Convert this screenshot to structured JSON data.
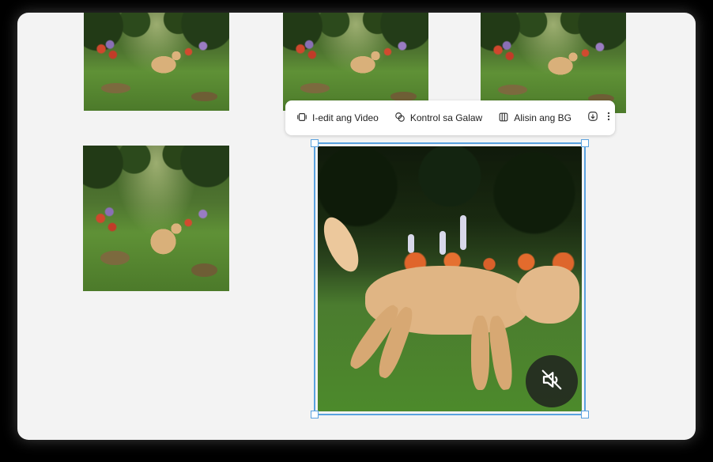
{
  "toolbar": {
    "edit_video_label": "I-edit ang Video",
    "motion_control_label": "Kontrol sa Galaw",
    "remove_bg_label": "Alisin ang BG",
    "download_icon": "download-icon",
    "more_icon": "more-vertical-icon"
  },
  "canvas": {
    "thumbnail_count": 4,
    "selected_media": "video",
    "mute_icon": "muted-speaker-icon"
  },
  "colors": {
    "canvas_bg": "#f3f3f3",
    "selection": "#5aa2df",
    "toolbar_bg": "#ffffff",
    "mute_button_bg": "#1e1e1e"
  }
}
